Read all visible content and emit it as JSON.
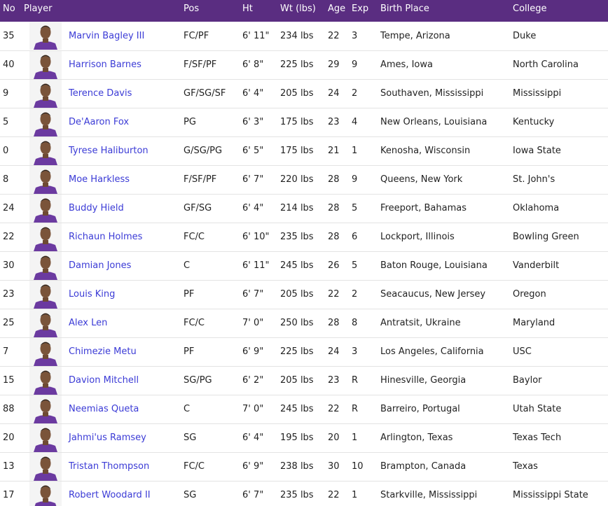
{
  "columns": {
    "no": "No",
    "player": "Player",
    "pos": "Pos",
    "ht": "Ht",
    "wt": "Wt (lbs)",
    "age": "Age",
    "exp": "Exp",
    "birth_place": "Birth Place",
    "college": "College"
  },
  "colors": {
    "header_bg": "#5a2d81",
    "header_text": "#ffffff",
    "link": "#3b3bd6",
    "jersey": "#6b3aa0"
  },
  "icons": {
    "headshot": "player-headshot-icon"
  },
  "rows": [
    {
      "no": "35",
      "name": "Marvin Bagley III",
      "pos": "FC/PF",
      "ht": "6' 11\"",
      "wt": "234 lbs",
      "age": "22",
      "exp": "3",
      "birth": "Tempe, Arizona",
      "college": "Duke"
    },
    {
      "no": "40",
      "name": "Harrison Barnes",
      "pos": "F/SF/PF",
      "ht": "6' 8\"",
      "wt": "225 lbs",
      "age": "29",
      "exp": "9",
      "birth": "Ames, Iowa",
      "college": "North Carolina"
    },
    {
      "no": "9",
      "name": "Terence Davis",
      "pos": "GF/SG/SF",
      "ht": "6' 4\"",
      "wt": "205 lbs",
      "age": "24",
      "exp": "2",
      "birth": "Southaven, Mississippi",
      "college": "Mississippi"
    },
    {
      "no": "5",
      "name": "De'Aaron Fox",
      "pos": "PG",
      "ht": "6' 3\"",
      "wt": "175 lbs",
      "age": "23",
      "exp": "4",
      "birth": "New Orleans, Louisiana",
      "college": "Kentucky"
    },
    {
      "no": "0",
      "name": "Tyrese Haliburton",
      "pos": "G/SG/PG",
      "ht": "6' 5\"",
      "wt": "175 lbs",
      "age": "21",
      "exp": "1",
      "birth": "Kenosha, Wisconsin",
      "college": "Iowa State"
    },
    {
      "no": "8",
      "name": "Moe Harkless",
      "pos": "F/SF/PF",
      "ht": "6' 7\"",
      "wt": "220 lbs",
      "age": "28",
      "exp": "9",
      "birth": "Queens, New York",
      "college": "St. John's"
    },
    {
      "no": "24",
      "name": "Buddy Hield",
      "pos": "GF/SG",
      "ht": "6' 4\"",
      "wt": "214 lbs",
      "age": "28",
      "exp": "5",
      "birth": "Freeport, Bahamas",
      "college": "Oklahoma"
    },
    {
      "no": "22",
      "name": "Richaun Holmes",
      "pos": "FC/C",
      "ht": "6' 10\"",
      "wt": "235 lbs",
      "age": "28",
      "exp": "6",
      "birth": "Lockport, Illinois",
      "college": "Bowling Green"
    },
    {
      "no": "30",
      "name": "Damian Jones",
      "pos": "C",
      "ht": "6' 11\"",
      "wt": "245 lbs",
      "age": "26",
      "exp": "5",
      "birth": "Baton Rouge, Louisiana",
      "college": "Vanderbilt"
    },
    {
      "no": "23",
      "name": "Louis King",
      "pos": "PF",
      "ht": "6' 7\"",
      "wt": "205 lbs",
      "age": "22",
      "exp": "2",
      "birth": "Seacaucus, New Jersey",
      "college": "Oregon"
    },
    {
      "no": "25",
      "name": "Alex Len",
      "pos": "FC/C",
      "ht": "7' 0\"",
      "wt": "250 lbs",
      "age": "28",
      "exp": "8",
      "birth": "Antratsit, Ukraine",
      "college": "Maryland"
    },
    {
      "no": "7",
      "name": "Chimezie Metu",
      "pos": "PF",
      "ht": "6' 9\"",
      "wt": "225 lbs",
      "age": "24",
      "exp": "3",
      "birth": "Los Angeles, California",
      "college": "USC"
    },
    {
      "no": "15",
      "name": "Davion Mitchell",
      "pos": "SG/PG",
      "ht": "6' 2\"",
      "wt": "205 lbs",
      "age": "23",
      "exp": "R",
      "birth": "Hinesville, Georgia",
      "college": "Baylor"
    },
    {
      "no": "88",
      "name": "Neemias Queta",
      "pos": "C",
      "ht": "7' 0\"",
      "wt": "245 lbs",
      "age": "22",
      "exp": "R",
      "birth": "Barreiro, Portugal",
      "college": "Utah State"
    },
    {
      "no": "20",
      "name": "Jahmi'us Ramsey",
      "pos": "SG",
      "ht": "6' 4\"",
      "wt": "195 lbs",
      "age": "20",
      "exp": "1",
      "birth": "Arlington, Texas",
      "college": "Texas Tech"
    },
    {
      "no": "13",
      "name": "Tristan Thompson",
      "pos": "FC/C",
      "ht": "6' 9\"",
      "wt": "238 lbs",
      "age": "30",
      "exp": "10",
      "birth": "Brampton, Canada",
      "college": "Texas"
    },
    {
      "no": "17",
      "name": "Robert Woodard II",
      "pos": "SG",
      "ht": "6' 7\"",
      "wt": "235 lbs",
      "age": "22",
      "exp": "1",
      "birth": "Starkville, Mississippi",
      "college": "Mississippi State"
    }
  ]
}
